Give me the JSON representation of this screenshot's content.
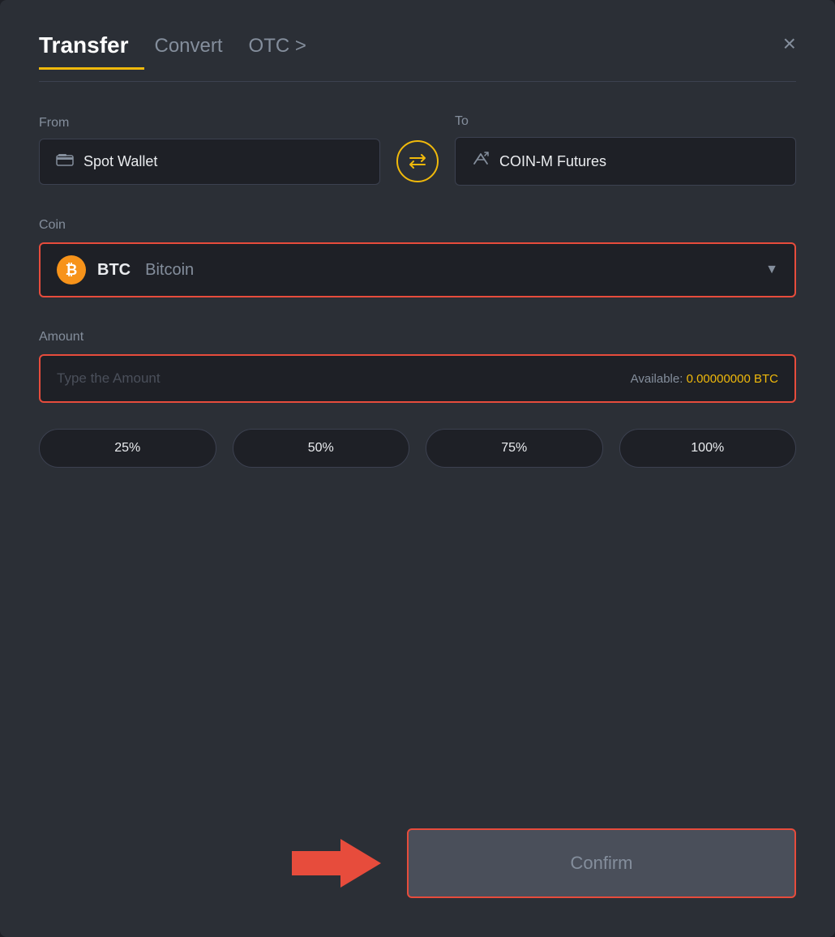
{
  "modal": {
    "title": "Transfer",
    "tabs": [
      {
        "label": "Transfer",
        "active": true
      },
      {
        "label": "Convert",
        "active": false
      },
      {
        "label": "OTC >",
        "active": false
      }
    ],
    "close_label": "×"
  },
  "from": {
    "label": "From",
    "wallet_name": "Spot Wallet"
  },
  "to": {
    "label": "To",
    "wallet_name": "COIN-M Futures"
  },
  "coin": {
    "label": "Coin",
    "symbol": "BTC",
    "full_name": "Bitcoin"
  },
  "amount": {
    "label": "Amount",
    "placeholder": "Type the Amount",
    "available_label": "Available:",
    "available_value": "0.00000000",
    "available_currency": "BTC"
  },
  "percent_buttons": [
    "25%",
    "50%",
    "75%",
    "100%"
  ],
  "confirm_button": "Confirm",
  "swap_icon": "⇄"
}
